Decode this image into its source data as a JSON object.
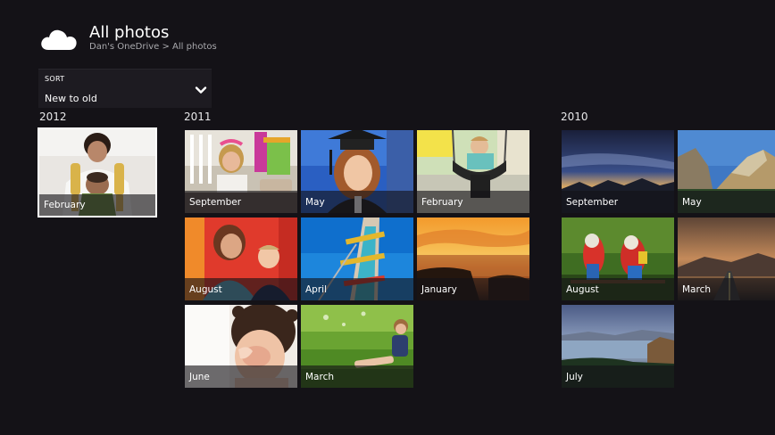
{
  "header": {
    "logo_icon": "onedrive-cloud-icon",
    "title": "All photos",
    "breadcrumb": "Dan's OneDrive > All photos"
  },
  "sort": {
    "label": "SORT",
    "value": "New to old",
    "icon": "chevron-down-icon"
  },
  "groups": [
    {
      "year": "2012",
      "photos": [
        {
          "month": "February",
          "selected": true
        }
      ]
    },
    {
      "year": "2011",
      "photos": [
        {
          "month": "September"
        },
        {
          "month": "May"
        },
        {
          "month": "February"
        },
        {
          "month": "August"
        },
        {
          "month": "April"
        },
        {
          "month": "January"
        },
        {
          "month": "June"
        },
        {
          "month": "March"
        }
      ]
    },
    {
      "year": "2010",
      "photos": [
        {
          "month": "September"
        },
        {
          "month": "May"
        },
        {
          "month": "August"
        },
        {
          "month": "March"
        },
        {
          "month": "July"
        }
      ]
    }
  ],
  "colors": {
    "background": "#141217",
    "breadcrumb": "#a9a9ad",
    "caption_overlay": "#141217"
  }
}
